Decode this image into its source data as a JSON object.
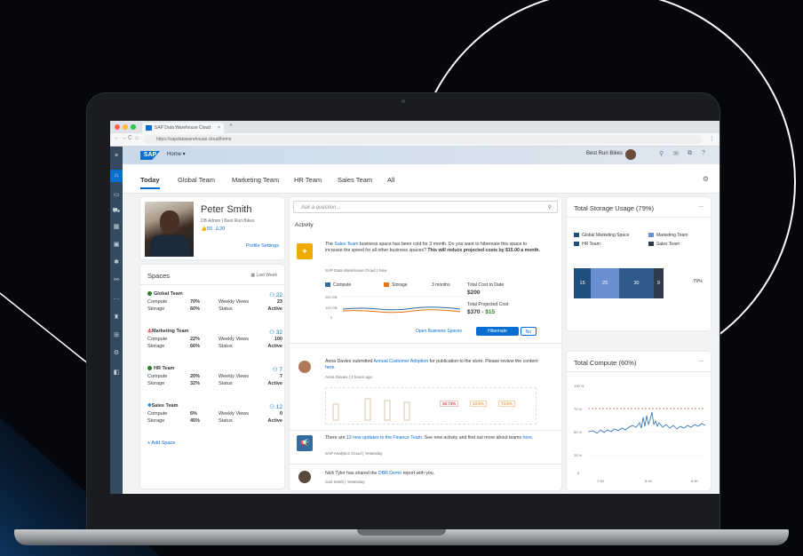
{
  "browser": {
    "tab_title": "SAP Data Warehouse Cloud",
    "tab_close": "×",
    "tab_new": "+",
    "url": "https://sapdatawarehouse.cloud/home",
    "nav_back": "←",
    "nav_forward": "→",
    "nav_reload": "C",
    "nav_home": "⌂",
    "menu": "⋮"
  },
  "shell": {
    "logo": "SAP",
    "home_label": "Home ▾",
    "company": "Best Run Bikes",
    "icons": [
      "search-icon",
      "notifications-icon",
      "copilot-icon",
      "help-icon"
    ]
  },
  "left_nav": {
    "menu": "≡",
    "items": [
      "home-icon",
      "data-builder-icon",
      "cart-icon",
      "calendar-icon",
      "monitor-icon",
      "settings-icon",
      "network-icon",
      "more-icon",
      "security-icon",
      "connection-icon",
      "gear-icon",
      "sidebar-icon"
    ]
  },
  "tabs": [
    {
      "label": "Today",
      "active": true
    },
    {
      "label": "Global Team"
    },
    {
      "label": "Marketing Team"
    },
    {
      "label": "HR Team"
    },
    {
      "label": "Sales Team"
    },
    {
      "label": "All"
    }
  ],
  "profile": {
    "name": "Peter Smith",
    "role": "DB Admin | Best Run Bikes",
    "likes": "55",
    "people": "20",
    "settings_link": "Profile Settings"
  },
  "spaces": {
    "title": "Spaces",
    "filter": "Last Week",
    "add_label": "+ Add Space",
    "labels": {
      "compute": "Compute",
      "storage": "Storage",
      "views": "Weekly Views",
      "status": "Status"
    },
    "items": [
      {
        "name": "Global Team",
        "count": "22",
        "compute": "70%",
        "storage": "60%",
        "views": "23",
        "status": "Active",
        "color": "#2b7d2b"
      },
      {
        "name": "Marketing Team",
        "count": "32",
        "compute": "22%",
        "storage": "66%",
        "views": "100",
        "status": "Active",
        "color": "#bb0000"
      },
      {
        "name": "HR Team",
        "count": "7",
        "compute": "20%",
        "storage": "32%",
        "views": "7",
        "status": "Active",
        "color": "#2b7d2b"
      },
      {
        "name": "Sales Team",
        "count": "12",
        "compute": "6%",
        "storage": "45%",
        "views": "0",
        "status": "Active",
        "color": "#0a6ed1"
      }
    ]
  },
  "search": {
    "placeholder": "Ask a question..."
  },
  "activity": {
    "title": "Activity",
    "hibernate": {
      "text_pre": "The ",
      "link": "Sales Team",
      "text_post": " business space has been cold for 3 month. Do you want to hibernate this space to increase the speed for all other business spaces?",
      "bold": " This will reduce projected costs by $15.00 a month.",
      "meta": "SAP Data Warehouse Cloud | Now",
      "legend_compute": "Compute",
      "legend_storage": "Storage",
      "period": "3 months",
      "y_top": "200 GB",
      "y_mid": "100 GB",
      "y_bottom": "0",
      "cost_label": "Total Cost to Date",
      "cost_value": "$200",
      "proj_label": "Total Projected Cost",
      "proj_value": "$370",
      "proj_delta": "- $15",
      "open_btn": "Open Business Spaces",
      "hibernate_btn": "Hibernate",
      "no_btn": "No"
    },
    "adoption": {
      "text_pre": "Anna Davies submitted ",
      "link": "Annual Customer Adoption",
      "text_post": " for publication to the store. Please review the content ",
      "link2": "here",
      "meta": "Anna Davies | 2 hours ago",
      "kpis": [
        "38.73%",
        "43.5%",
        "73.6%"
      ]
    },
    "updates": {
      "text_pre": "There are ",
      "link": "12 new updates to the Finance Team",
      "text_post": ". See new activity and find out more about teams ",
      "link2": "here",
      "meta": "SAP Analytics Cloud | Yesterday"
    },
    "share": {
      "text_pre": "Nick Tylor has shared the ",
      "link": "DBR Demo",
      "text_post": " report with you.",
      "meta": "Carl Smith | Yesterday"
    }
  },
  "storage": {
    "title": "Total Storage Usage (79%)",
    "more": "...",
    "legend": [
      {
        "name": "Global Marketing Space",
        "color": "#1f4f7d"
      },
      {
        "name": "Marketing Team",
        "color": "#6a8fd0"
      },
      {
        "name": "HR Team",
        "color": "#1f4f7d"
      },
      {
        "name": "Sales Team",
        "color": "#2d3b4a"
      }
    ],
    "segments": [
      {
        "value": "15",
        "share": 15,
        "color": "#1f4f7d"
      },
      {
        "value": "25",
        "share": 25,
        "color": "#6a8fd0"
      },
      {
        "value": "30",
        "share": 30,
        "color": "#2d5a8a"
      },
      {
        "value": "9",
        "share": 9,
        "color": "#2d3b4a"
      }
    ],
    "total": "79%"
  },
  "compute": {
    "title": "Total Compute (60%)",
    "more": "...",
    "y_labels": [
      "100 %",
      "75 %",
      "50 %",
      "25 %",
      "0"
    ],
    "x_labels": [
      "7:30",
      "8:30",
      "9:30"
    ],
    "threshold_color": "#d9534f",
    "line_color": "#2d6fb4"
  }
}
